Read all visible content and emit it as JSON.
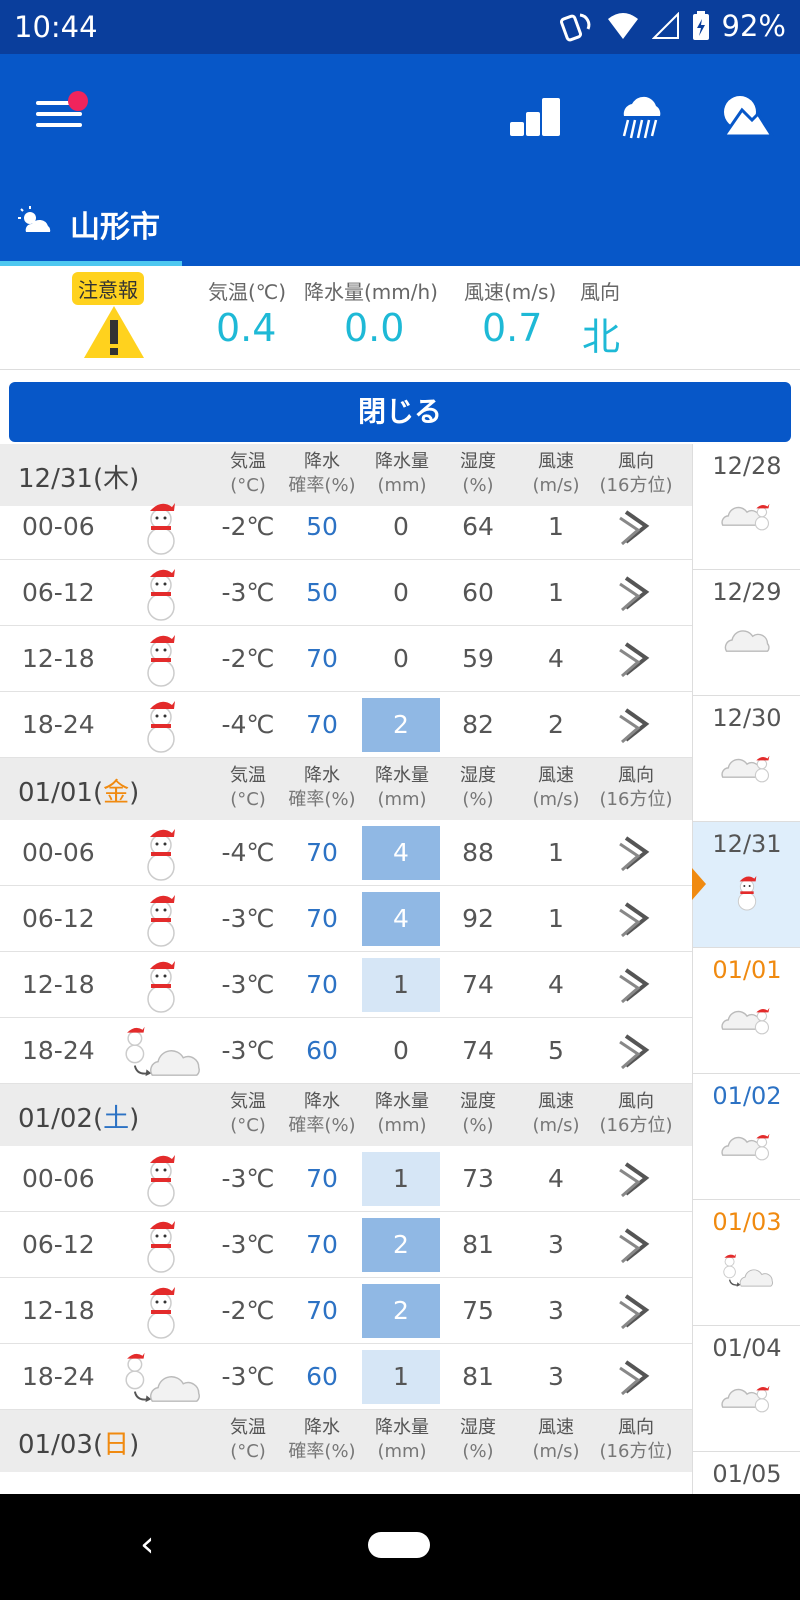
{
  "status_bar": {
    "time": "10:44",
    "battery": "92%"
  },
  "location": {
    "name": "山形市"
  },
  "observation": {
    "warning_label": "注意報",
    "labels": [
      "気温(℃)",
      "降水量(mm/h)",
      "風速(m/s)",
      "風向"
    ],
    "values": [
      "0.4",
      "0.0",
      "0.7",
      "北"
    ]
  },
  "close_button": "閉じる",
  "column_headers": {
    "temp": "気温",
    "temp_unit": "(°C)",
    "prob": "降水",
    "prob_unit": "確率(%)",
    "amt": "降水量",
    "amt_unit": "(mm)",
    "hum": "湿度",
    "hum_unit": "(%)",
    "wspd": "風速",
    "wspd_unit": "(m/s)",
    "wdir": "風向",
    "wdir_unit": "(16方位)"
  },
  "days": [
    {
      "date": "12/31",
      "dow": "木",
      "dow_color": "#444444",
      "rows": [
        {
          "time": "00-06",
          "icon": "snowman-icon",
          "temp": "-2℃",
          "prob": "50",
          "amt": "0",
          "amt_level": 0,
          "hum": "64",
          "wspd": "1",
          "wdir": "wind-direction-icon"
        },
        {
          "time": "06-12",
          "icon": "snowman-icon",
          "temp": "-3℃",
          "prob": "50",
          "amt": "0",
          "amt_level": 0,
          "hum": "60",
          "wspd": "1",
          "wdir": "wind-direction-icon"
        },
        {
          "time": "12-18",
          "icon": "snowman-icon",
          "temp": "-2℃",
          "prob": "70",
          "amt": "0",
          "amt_level": 0,
          "hum": "59",
          "wspd": "4",
          "wdir": "wind-direction-icon"
        },
        {
          "time": "18-24",
          "icon": "snowman-icon",
          "temp": "-4℃",
          "prob": "70",
          "amt": "2",
          "amt_level": 2,
          "hum": "82",
          "wspd": "2",
          "wdir": "wind-direction-icon"
        }
      ]
    },
    {
      "date": "01/01",
      "dow": "金",
      "dow_color": "#f08a10",
      "rows": [
        {
          "time": "00-06",
          "icon": "snowman-icon",
          "temp": "-4℃",
          "prob": "70",
          "amt": "4",
          "amt_level": 2,
          "hum": "88",
          "wspd": "1",
          "wdir": "wind-direction-icon"
        },
        {
          "time": "06-12",
          "icon": "snowman-icon",
          "temp": "-3℃",
          "prob": "70",
          "amt": "4",
          "amt_level": 2,
          "hum": "92",
          "wspd": "1",
          "wdir": "wind-direction-icon"
        },
        {
          "time": "12-18",
          "icon": "snowman-icon",
          "temp": "-3℃",
          "prob": "70",
          "amt": "1",
          "amt_level": 1,
          "hum": "74",
          "wspd": "4",
          "wdir": "wind-direction-icon"
        },
        {
          "time": "18-24",
          "icon": "snow-then-cloud-icon",
          "temp": "-3℃",
          "prob": "60",
          "amt": "0",
          "amt_level": 0,
          "hum": "74",
          "wspd": "5",
          "wdir": "wind-direction-icon"
        }
      ]
    },
    {
      "date": "01/02",
      "dow": "土",
      "dow_color": "#2c72c4",
      "rows": [
        {
          "time": "00-06",
          "icon": "snowman-icon",
          "temp": "-3℃",
          "prob": "70",
          "amt": "1",
          "amt_level": 1,
          "hum": "73",
          "wspd": "4",
          "wdir": "wind-direction-icon"
        },
        {
          "time": "06-12",
          "icon": "snowman-icon",
          "temp": "-3℃",
          "prob": "70",
          "amt": "2",
          "amt_level": 2,
          "hum": "81",
          "wspd": "3",
          "wdir": "wind-direction-icon"
        },
        {
          "time": "12-18",
          "icon": "snowman-icon",
          "temp": "-2℃",
          "prob": "70",
          "amt": "2",
          "amt_level": 2,
          "hum": "75",
          "wspd": "3",
          "wdir": "wind-direction-icon"
        },
        {
          "time": "18-24",
          "icon": "snow-then-cloud-icon",
          "temp": "-3℃",
          "prob": "60",
          "amt": "1",
          "amt_level": 1,
          "hum": "81",
          "wspd": "3",
          "wdir": "wind-direction-icon"
        }
      ]
    },
    {
      "date": "01/03",
      "dow": "日",
      "dow_color": "#f08a10",
      "rows": []
    }
  ],
  "side_dates": [
    {
      "date": "12/28",
      "color": "#555555",
      "icon": "cloud-snow-icon",
      "selected": false
    },
    {
      "date": "12/29",
      "color": "#555555",
      "icon": "cloud-icon",
      "selected": false
    },
    {
      "date": "12/30",
      "color": "#555555",
      "icon": "cloud-snow-icon",
      "selected": false
    },
    {
      "date": "12/31",
      "color": "#555555",
      "icon": "snowman-icon",
      "selected": true
    },
    {
      "date": "01/01",
      "color": "#f08a10",
      "icon": "snow-cloud-icon",
      "selected": false
    },
    {
      "date": "01/02",
      "color": "#2c72c4",
      "icon": "snow-cloud-icon",
      "selected": false
    },
    {
      "date": "01/03",
      "color": "#f08a10",
      "icon": "snow-then-cloud-icon",
      "selected": false
    },
    {
      "date": "01/04",
      "color": "#555555",
      "icon": "cloud-snow-icon",
      "selected": false
    },
    {
      "date": "01/05",
      "color": "#555555",
      "icon": "cloud-icon",
      "selected": false
    }
  ],
  "colors": {
    "appbar": "#0757c8",
    "statusbar": "#0a3e9c",
    "value_cyan": "#1eb9d6",
    "accent_orange": "#f08a10"
  }
}
